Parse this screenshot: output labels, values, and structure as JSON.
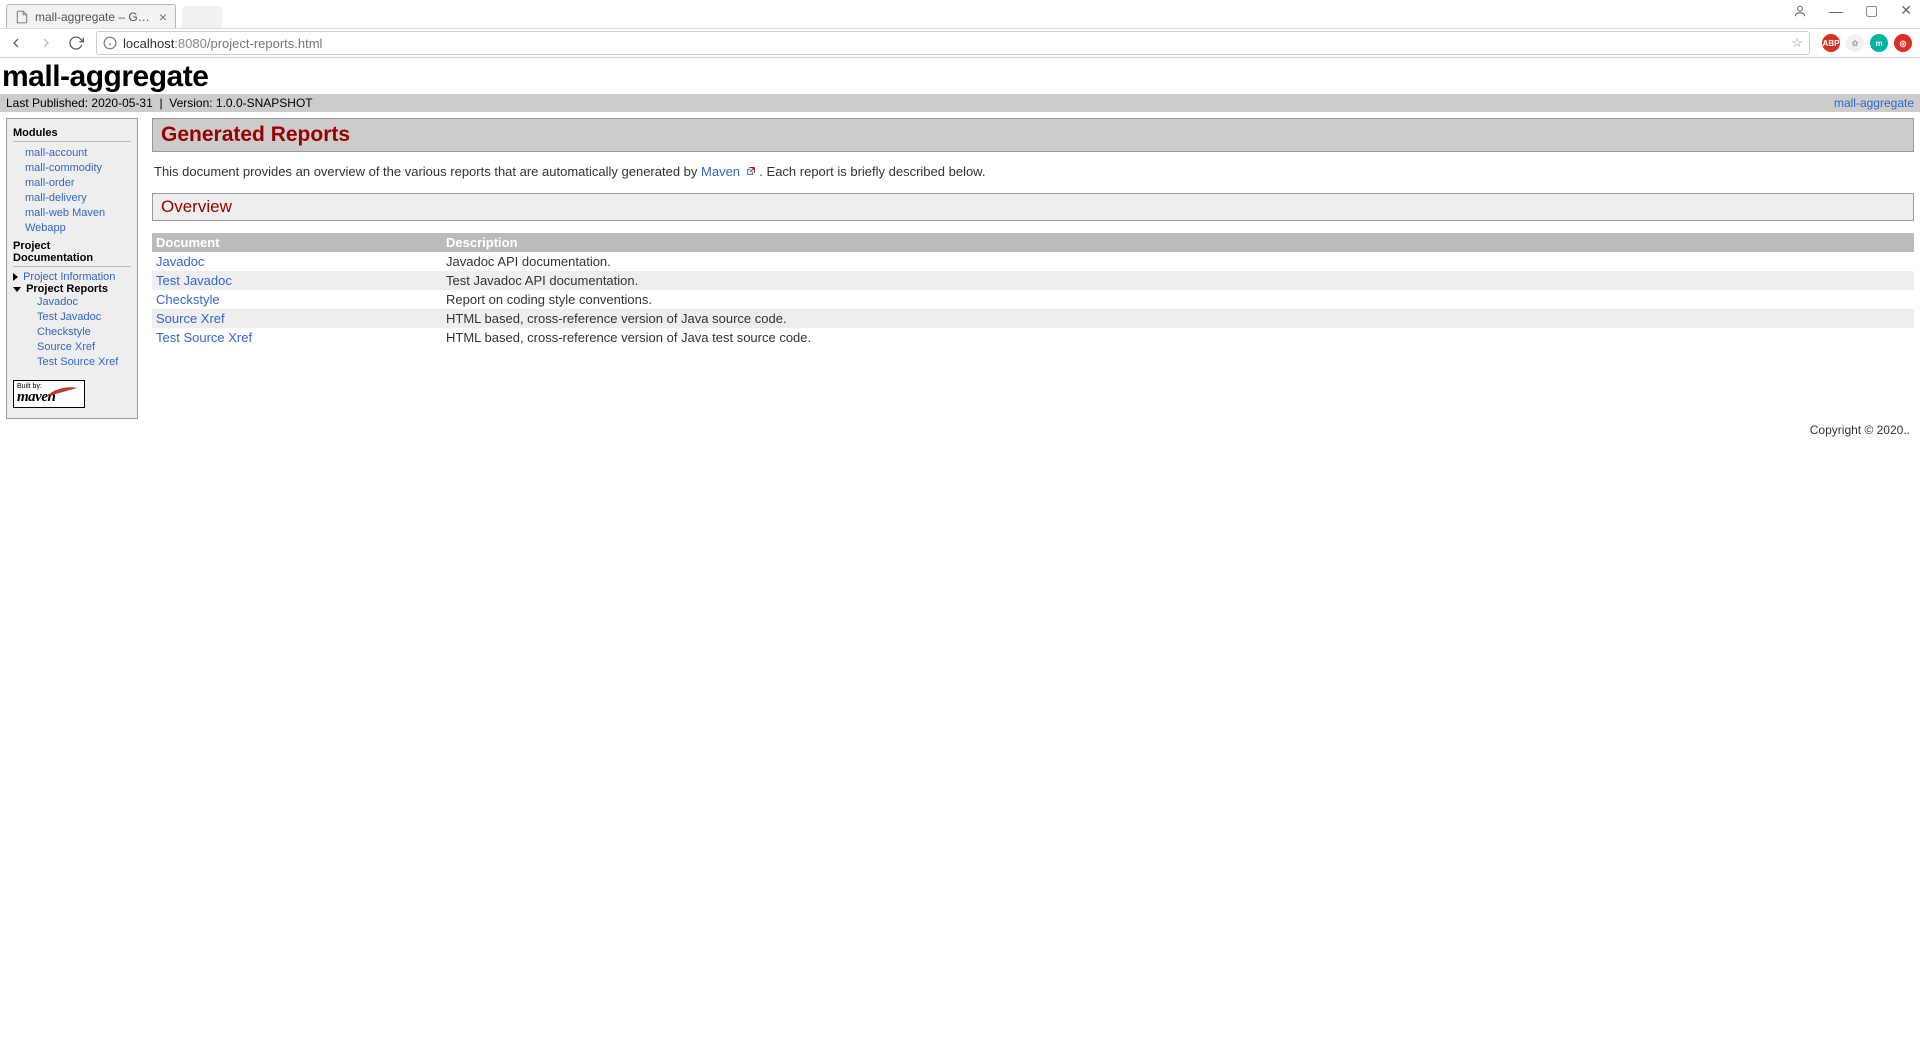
{
  "browser": {
    "tab_title": "mall-aggregate – Gene",
    "url_host": "localhost",
    "url_port": ":8080",
    "url_path": "/project-reports.html"
  },
  "page": {
    "title": "mall-aggregate",
    "last_published_label": "Last Published: 2020-05-31",
    "version_label": "Version: 1.0.0-SNAPSHOT",
    "breadcrumb_link": "mall-aggregate"
  },
  "nav": {
    "modules_heading": "Modules",
    "modules": [
      "mall-account",
      "mall-commodity",
      "mall-order",
      "mall-delivery",
      "mall-web Maven Webapp"
    ],
    "docs_heading": "Project Documentation",
    "project_info": "Project Information",
    "project_reports": "Project Reports",
    "reports": [
      "Javadoc",
      "Test Javadoc",
      "Checkstyle",
      "Source Xref",
      "Test Source Xref"
    ],
    "built_by": "Built by:",
    "maven_logo_text": "maven"
  },
  "content": {
    "h2": "Generated Reports",
    "intro_pre": "This document provides an overview of the various reports that are automatically generated by ",
    "intro_link": "Maven",
    "intro_post": " . Each report is briefly described below.",
    "h3": "Overview",
    "th_doc": "Document",
    "th_desc": "Description",
    "rows": [
      {
        "doc": "Javadoc",
        "desc": "Javadoc API documentation."
      },
      {
        "doc": "Test Javadoc",
        "desc": "Test Javadoc API documentation."
      },
      {
        "doc": "Checkstyle",
        "desc": "Report on coding style conventions."
      },
      {
        "doc": "Source Xref",
        "desc": "HTML based, cross-reference version of Java source code."
      },
      {
        "doc": "Test Source Xref",
        "desc": "HTML based, cross-reference version of Java test source code."
      }
    ]
  },
  "footer": "Copyright © 2020.."
}
